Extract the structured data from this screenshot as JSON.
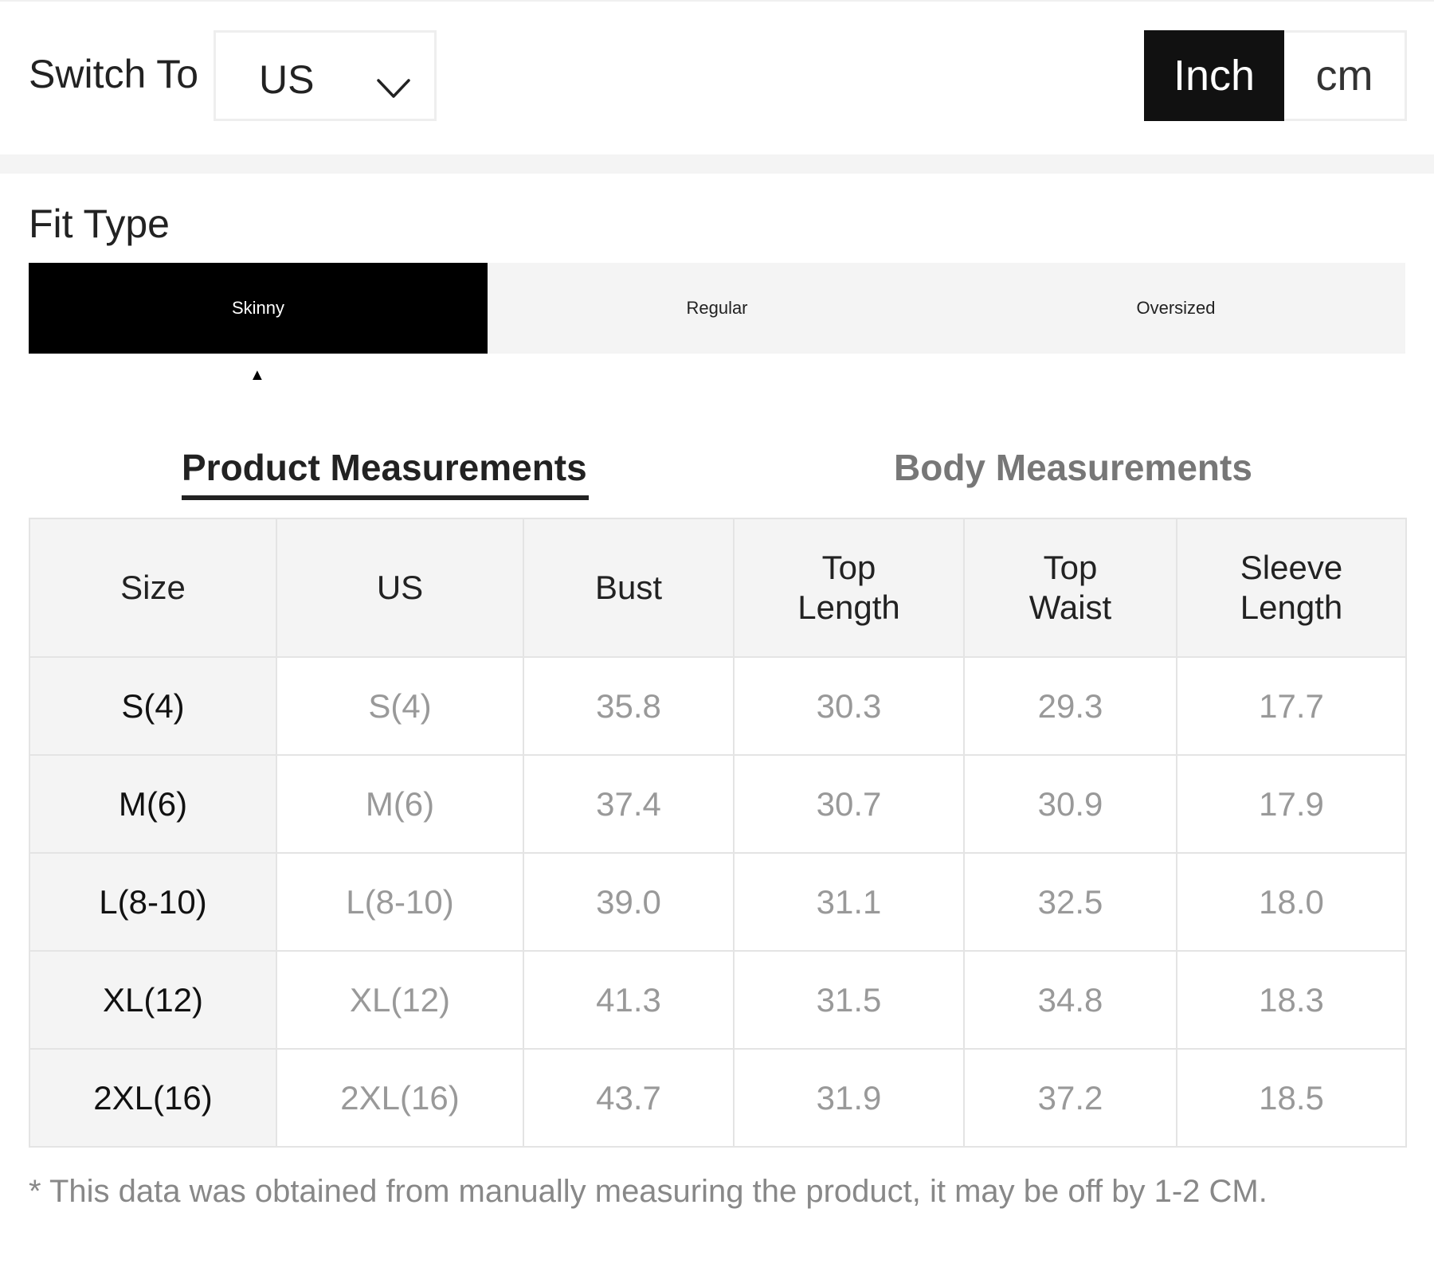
{
  "header": {
    "switch_label": "Switch To",
    "region_value": "US",
    "units": [
      {
        "label": "Inch",
        "selected": true
      },
      {
        "label": "cm",
        "selected": false
      }
    ]
  },
  "fit": {
    "title": "Fit Type",
    "tabs": [
      {
        "label": "Skinny",
        "selected": true
      },
      {
        "label": "Regular",
        "selected": false
      },
      {
        "label": "Oversized",
        "selected": false
      }
    ],
    "pointer_glyph": "▲"
  },
  "measurement_tabs": {
    "product": "Product Measurements",
    "body": "Body Measurements",
    "active": "product"
  },
  "table": {
    "headers": [
      [
        "Size"
      ],
      [
        "US"
      ],
      [
        "Bust"
      ],
      [
        "Top",
        "Length"
      ],
      [
        "Top",
        "Waist"
      ],
      [
        "Sleeve",
        "Length"
      ]
    ],
    "rows": [
      [
        "S(4)",
        "S(4)",
        "35.8",
        "30.3",
        "29.3",
        "17.7"
      ],
      [
        "M(6)",
        "M(6)",
        "37.4",
        "30.7",
        "30.9",
        "17.9"
      ],
      [
        "L(8-10)",
        "L(8-10)",
        "39.0",
        "31.1",
        "32.5",
        "18.0"
      ],
      [
        "XL(12)",
        "XL(12)",
        "41.3",
        "31.5",
        "34.8",
        "18.3"
      ],
      [
        "2XL(16)",
        "2XL(16)",
        "43.7",
        "31.9",
        "37.2",
        "18.5"
      ]
    ]
  },
  "footnote": "* This data was obtained from manually measuring the product, it may be off by 1-2 CM.",
  "colors": {
    "primary": "#111111",
    "tab_bg": "#f4f4f4",
    "muted_text": "#999999",
    "border": "#e4e4e4"
  }
}
